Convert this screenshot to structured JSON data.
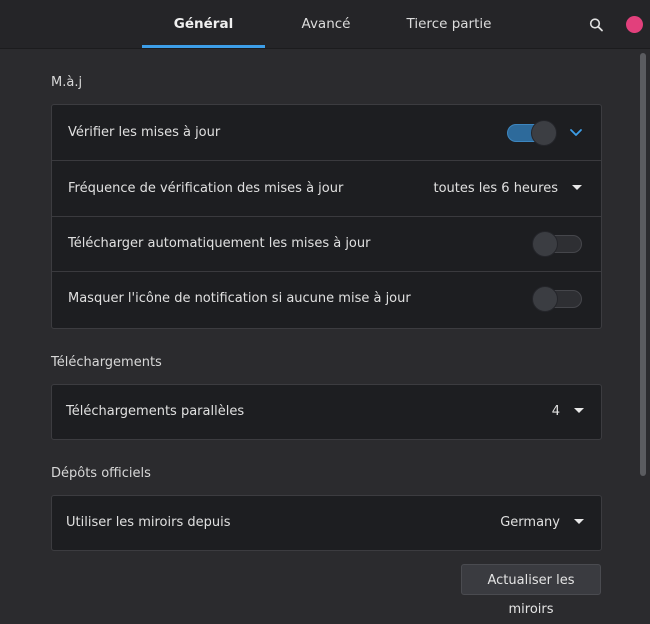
{
  "tabs": [
    {
      "label": "Général",
      "active": true
    },
    {
      "label": "Avancé",
      "active": false
    },
    {
      "label": "Tierce partie",
      "active": false
    }
  ],
  "header_icons": {
    "search": "search-icon",
    "close": "close-icon",
    "close_color": "#e2407c"
  },
  "accent_color": "#3d9ee8",
  "sections": {
    "updates": {
      "title": "M.à.j",
      "rows": [
        {
          "label": "Vérifier les mises à jour",
          "toggle": true,
          "expander": "chevron-down-icon"
        },
        {
          "label": "Fréquence de vérification des mises à jour",
          "dropdown_value": "toutes les 6 heures"
        },
        {
          "label": "Télécharger automatiquement les mises à jour",
          "toggle": false
        },
        {
          "label": "Masquer l'icône de notification si aucune mise à jour",
          "toggle": false
        }
      ]
    },
    "downloads": {
      "title": "Téléchargements",
      "rows": [
        {
          "label": "Téléchargements parallèles",
          "dropdown_value": "4"
        }
      ]
    },
    "official_repos": {
      "title": "Dépôts officiels",
      "rows": [
        {
          "label": "Utiliser les miroirs depuis",
          "dropdown_value": "Germany"
        }
      ]
    }
  },
  "refresh_button": {
    "label": "Actualiser les miroirs"
  }
}
